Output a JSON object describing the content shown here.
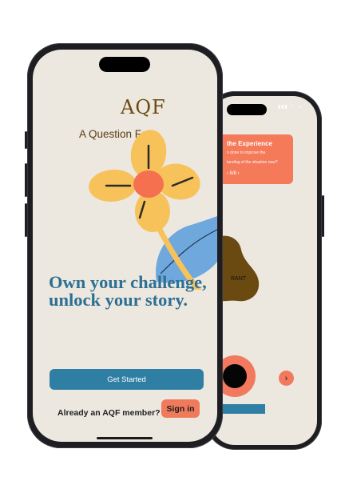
{
  "front": {
    "logo": "AQF",
    "subtitle": "A Question For",
    "headline": "Own your challenge, unlock your story.",
    "get_started_label": "Get Started",
    "member_prompt": "Already an AQF member?",
    "sign_in_label": "Sign in"
  },
  "back": {
    "card_title": "the Experience",
    "card_line_1": "n done to improve the",
    "card_line_2": "tanding of the situation now?",
    "card_nav": "‹   8/8   ›",
    "rant_label": "RANT",
    "next_icon": "›"
  },
  "colors": {
    "background": "#ece8df",
    "primary": "#2f7ea3",
    "accent": "#f47a5a",
    "brand_brown": "#6b4a12",
    "blob_brown": "#6b4a12",
    "flower_yellow": "#f7c25a",
    "flower_center": "#f4704f",
    "leaf_blue": "#6ea8dc"
  }
}
